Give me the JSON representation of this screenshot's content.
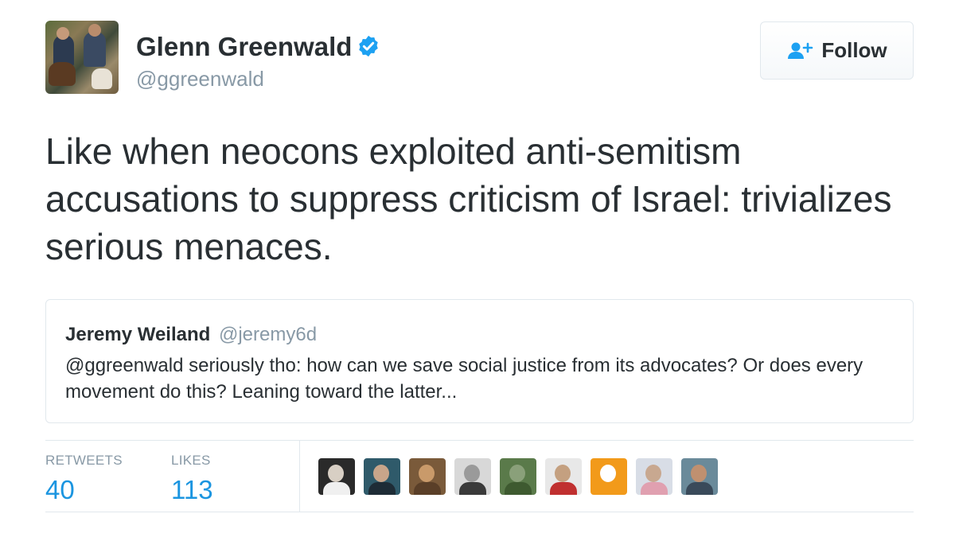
{
  "user": {
    "name": "Glenn Greenwald",
    "handle": "@ggreenwald",
    "verified": true
  },
  "follow_button": {
    "label": "Follow",
    "icon": "add-user-icon"
  },
  "tweet": {
    "text": "Like when neocons exploited anti-semitism accusations to suppress criticism of Israel: trivializes serious menaces."
  },
  "quoted_tweet": {
    "name": "Jeremy Weiland",
    "handle": "@jeremy6d",
    "text": "@ggreenwald seriously tho: how can we save social justice from its advocates? Or does every movement do this? Leaning toward the latter..."
  },
  "stats": {
    "retweets_label": "RETWEETS",
    "retweets_count": "40",
    "likes_label": "LIKES",
    "likes_count": "113"
  },
  "likers": [
    {
      "bg": "#2a2a2a",
      "face": "#d8cfc4",
      "body": "#f0f0f0"
    },
    {
      "bg": "#2f5a6a",
      "face": "#c8a58a",
      "body": "#1e2c36"
    },
    {
      "bg": "#7a5a3a",
      "face": "#c99a6a",
      "body": "#5a3f28"
    },
    {
      "bg": "#d8d8d8",
      "face": "#9a9a9a",
      "body": "#3a3a3a"
    },
    {
      "bg": "#5a7a4a",
      "face": "#8aa07a",
      "body": "#3e5a30"
    },
    {
      "bg": "#e8e8e8",
      "face": "#c4a080",
      "body": "#c03030"
    },
    {
      "bg": "#f29a1a",
      "face": "#ffffff",
      "body": "#f29a1a"
    },
    {
      "bg": "#d8dde6",
      "face": "#c8a890",
      "body": "#e0a0b0"
    },
    {
      "bg": "#6a8a9a",
      "face": "#c09070",
      "body": "#3a4a5a"
    }
  ],
  "colors": {
    "accent": "#1b95e0",
    "verified": "#1da1f2",
    "muted": "#8899a6",
    "text": "#292f33"
  }
}
